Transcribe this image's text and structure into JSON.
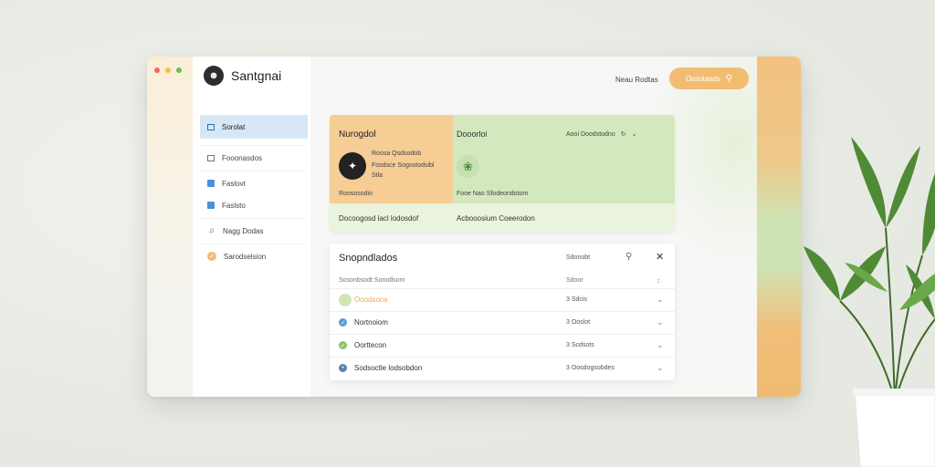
{
  "window": {
    "traffic_lights": [
      "#ee6a5f",
      "#f5c04f",
      "#61c354"
    ]
  },
  "sidebar": {
    "brand": "Santgnai",
    "items": [
      {
        "label": "Sorolat",
        "icon": "square-icon",
        "active": true
      },
      {
        "label": "Fooonasdos",
        "icon": "tray-icon",
        "active": false
      },
      {
        "label": "Faslovt",
        "icon": "tag-icon",
        "active": false
      },
      {
        "label": "Faslsto",
        "icon": "tag-icon",
        "active": false
      },
      {
        "label": "Nagg Dodas",
        "icon": "music-icon",
        "active": false
      },
      {
        "label": "Sarodselsion",
        "icon": "check-badge-icon",
        "active": false
      }
    ]
  },
  "header": {
    "link": "Neau Rodtas",
    "button": "Ossotasds",
    "accent": "#f2bd72"
  },
  "summary_card": {
    "left_title": "Nurogdol",
    "left_line1": "Roosa Qsdsodob",
    "left_line2": "Fosdsce Sogostodsibl",
    "left_line3": "Stla",
    "left_footer": "Roososodio",
    "right_title": "Dooorloi",
    "right_actions": "Aooi  Doodstodno",
    "right_footer": "Fooe Nao Sfodeondotom",
    "bottom_left": "Docoogosd lacl lodosdof",
    "bottom_right": "Acbooosium Coeerodon"
  },
  "list_card": {
    "title": "Snopndlados",
    "filter": "Sdonobt",
    "header_left": "Sosonbsodt Sorodlsom",
    "header_col": "Sdoor",
    "rows": [
      {
        "name": "Ooodsoca",
        "col": "3 Sdcis",
        "icon_color": "#cfe6b7",
        "highlight": true
      },
      {
        "name": "Nortnoiom",
        "col": "3 Ooslot",
        "icon_color": "#5a9bd5",
        "highlight": false
      },
      {
        "name": "Oorttecon",
        "col": "3 Scdsots",
        "icon_color": "#8cc461",
        "highlight": false
      },
      {
        "name": "Sodsoctle lodsobdon",
        "col": "3 Oosdogsobdes",
        "icon_color": "#5a7fb0",
        "highlight": false
      }
    ]
  }
}
